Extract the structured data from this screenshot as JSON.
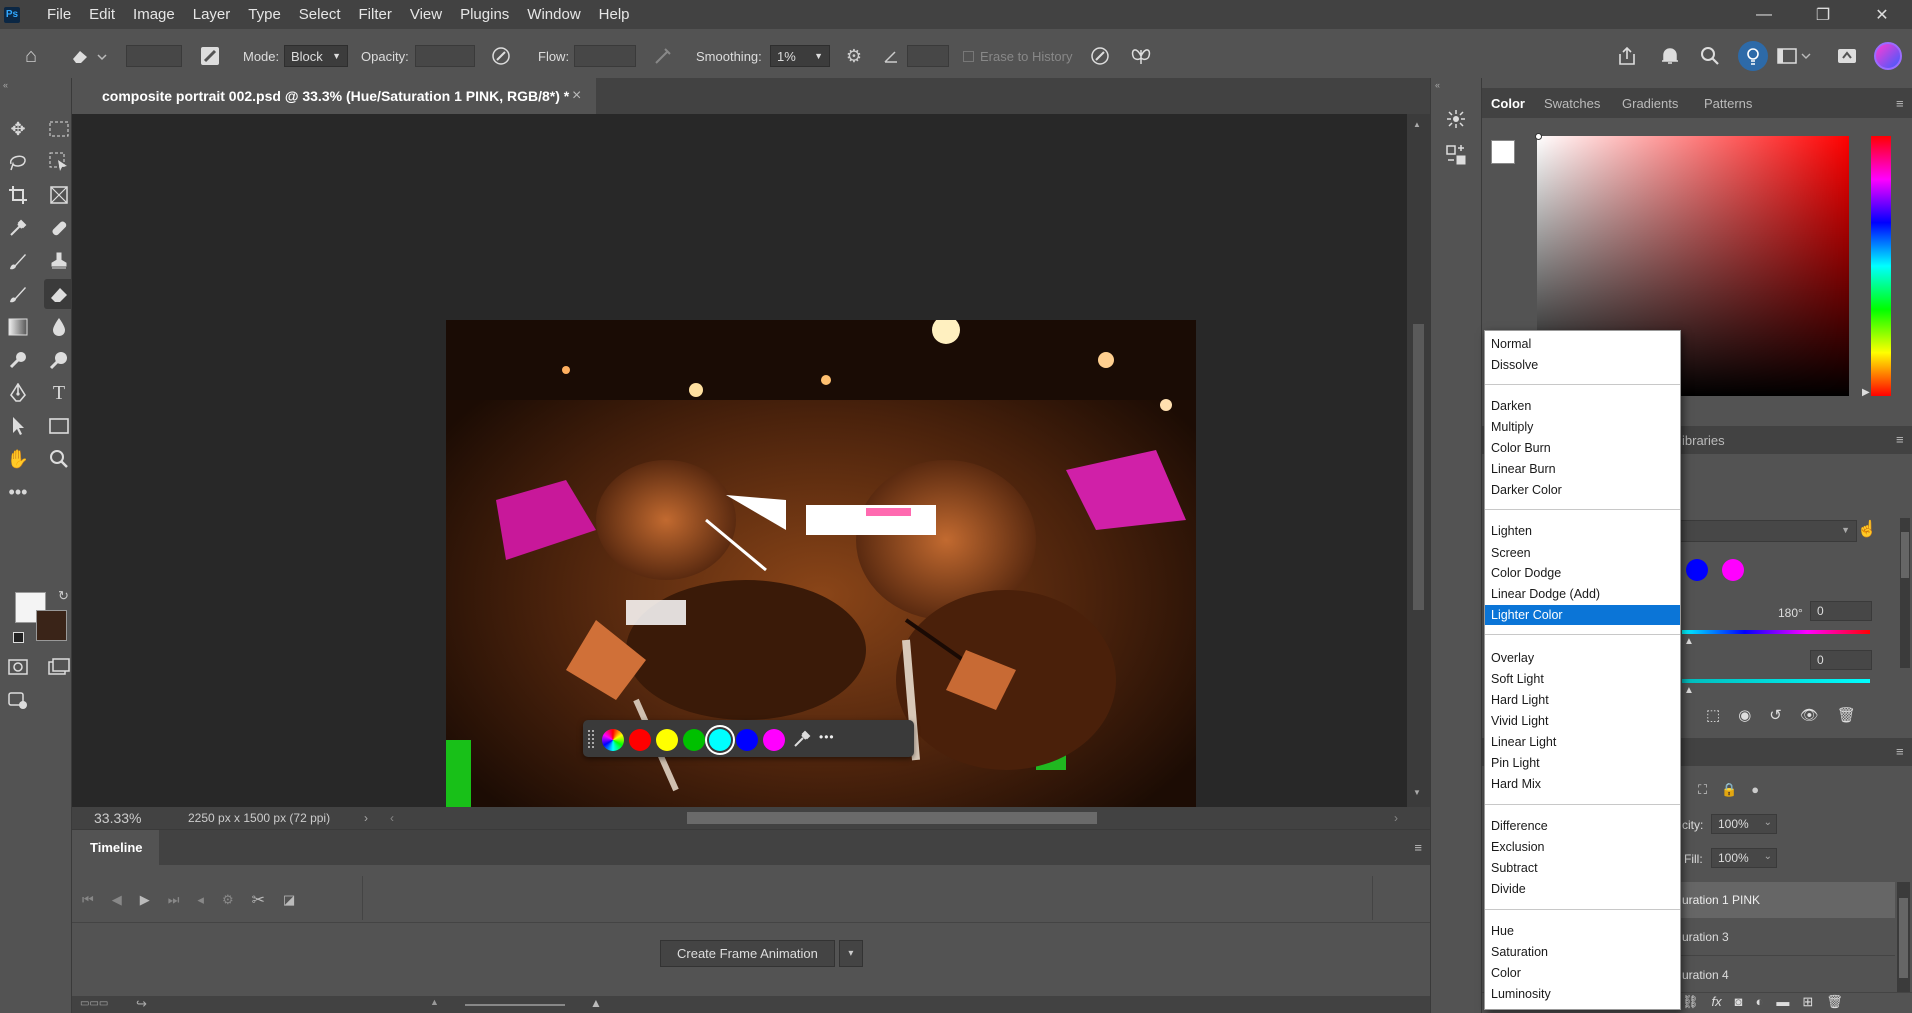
{
  "app": {
    "logo": "Ps"
  },
  "menu": [
    "File",
    "Edit",
    "Image",
    "Layer",
    "Type",
    "Select",
    "Filter",
    "View",
    "Plugins",
    "Window",
    "Help"
  ],
  "window_controls": {
    "minimize": "—",
    "restore": "❐",
    "close": "✕"
  },
  "options": {
    "mode_label": "Mode:",
    "mode_value": "Block",
    "opacity_label": "Opacity:",
    "flow_label": "Flow:",
    "smoothing_label": "Smoothing:",
    "smoothing_value": "1%",
    "erase_history_label": "Erase to History"
  },
  "document": {
    "tab_title": "composite portrait 002.psd @ 33.3% (Hue/Saturation 1 PINK, RGB/8*) *",
    "tab_close": "×",
    "zoom": "33.33%",
    "dimensions": "2250 px x 1500 px (72 ppi)"
  },
  "taskbar": {
    "colors": [
      "#ff0000",
      "#ffff00",
      "#00c000",
      "#00ffff",
      "#0000ff",
      "#ff00ff"
    ],
    "more": "•••"
  },
  "timeline": {
    "tab": "Timeline",
    "create_button": "Create Frame Animation"
  },
  "panels": {
    "color_tabs": [
      "Color",
      "Swatches",
      "Gradients",
      "Patterns"
    ],
    "libraries_tab_partial": "ibraries",
    "hue_degrees": "180°",
    "hue_value": "0",
    "sat_value": "0",
    "opacity_label_partial": "city:",
    "opacity_value": "100%",
    "fill_label": "Fill:",
    "fill_value": "100%",
    "layers": [
      "uration 1 PINK",
      "uration 3",
      "uration 4"
    ]
  },
  "blend_modes": {
    "groups": [
      [
        "Normal",
        "Dissolve"
      ],
      [
        "Darken",
        "Multiply",
        "Color Burn",
        "Linear Burn",
        "Darker Color"
      ],
      [
        "Lighten",
        "Screen",
        "Color Dodge",
        "Linear Dodge (Add)",
        "Lighter Color"
      ],
      [
        "Overlay",
        "Soft Light",
        "Hard Light",
        "Vivid Light",
        "Linear Light",
        "Pin Light",
        "Hard Mix"
      ],
      [
        "Difference",
        "Exclusion",
        "Subtract",
        "Divide"
      ],
      [
        "Hue",
        "Saturation",
        "Color",
        "Luminosity"
      ]
    ],
    "selected": "Lighter Color"
  }
}
